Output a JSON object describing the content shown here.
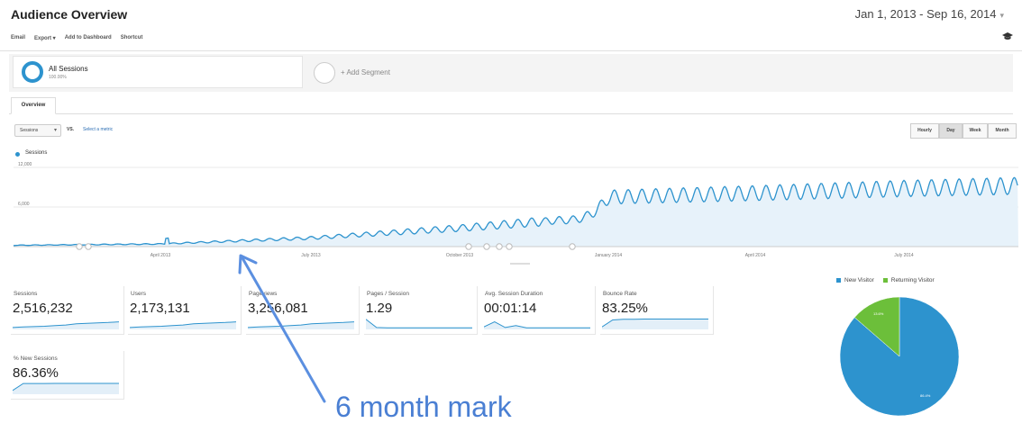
{
  "header": {
    "title": "Audience Overview",
    "date_range": "Jan 1, 2013 - Sep 16, 2014",
    "date_caret": "▾"
  },
  "toolbar": {
    "email": "Email",
    "export": "Export ▾",
    "add_to_dashboard": "Add to Dashboard",
    "shortcut": "Shortcut",
    "icon": "graduation-cap-icon"
  },
  "segments": {
    "all_label": "All Sessions",
    "all_percent": "100.00%",
    "add_label": "+ Add Segment"
  },
  "tabs": {
    "overview": "Overview"
  },
  "chart_controls": {
    "metric": "Sessions",
    "metric_caret": "▾",
    "vs": "VS.",
    "select_metric": "Select a metric",
    "periods": [
      "Hourly",
      "Day",
      "Week",
      "Month"
    ],
    "active_period": "Day"
  },
  "chart_data": {
    "type": "area",
    "series": [
      {
        "name": "Sessions",
        "color": "#2d93ce"
      }
    ],
    "ylim": [
      0,
      12000
    ],
    "y_ticks": [
      "12,000",
      "6,000"
    ],
    "x_ticks": [
      "April 2013",
      "July 2013",
      "October 2013",
      "January 2014",
      "April 2014",
      "July 2014"
    ],
    "trend": [
      {
        "x": "Jan 2013",
        "y": 200
      },
      {
        "x": "Apr 2013",
        "y": 400
      },
      {
        "x": "Jul 2013",
        "y": 1300
      },
      {
        "x": "Oct 2013",
        "y": 2800
      },
      {
        "x": "Dec 2013",
        "y": 4000
      },
      {
        "x": "Jan 2014",
        "y": 7500
      },
      {
        "x": "Apr 2014",
        "y": 8100
      },
      {
        "x": "Jul 2014",
        "y": 8800
      },
      {
        "x": "Sep 2014",
        "y": 9200
      }
    ],
    "weekly_oscillation": true
  },
  "metrics": [
    {
      "label": "Sessions",
      "value": "2,516,232",
      "spark": [
        0.15,
        0.2,
        0.22,
        0.25,
        0.3,
        0.35,
        0.45,
        0.48,
        0.52,
        0.55,
        0.6
      ]
    },
    {
      "label": "Users",
      "value": "2,173,131",
      "spark": [
        0.15,
        0.2,
        0.22,
        0.25,
        0.3,
        0.35,
        0.45,
        0.48,
        0.52,
        0.55,
        0.6
      ]
    },
    {
      "label": "Pageviews",
      "value": "3,256,081",
      "spark": [
        0.15,
        0.2,
        0.22,
        0.25,
        0.3,
        0.35,
        0.45,
        0.48,
        0.52,
        0.55,
        0.6
      ]
    },
    {
      "label": "Pages / Session",
      "value": "1.29",
      "spark": [
        0.8,
        0.15,
        0.12,
        0.12,
        0.12,
        0.12,
        0.12,
        0.12,
        0.12,
        0.12,
        0.12
      ]
    },
    {
      "label": "Avg. Session Duration",
      "value": "00:01:14",
      "spark": [
        0.2,
        0.6,
        0.15,
        0.3,
        0.12,
        0.12,
        0.12,
        0.12,
        0.12,
        0.12,
        0.12
      ]
    },
    {
      "label": "Bounce Rate",
      "value": "83.25%",
      "spark": [
        0.2,
        0.75,
        0.8,
        0.8,
        0.82,
        0.82,
        0.82,
        0.82,
        0.82,
        0.82,
        0.82
      ]
    },
    {
      "label": "% New Sessions",
      "value": "86.36%",
      "spark": [
        0.3,
        0.85,
        0.85,
        0.85,
        0.86,
        0.86,
        0.86,
        0.86,
        0.86,
        0.86,
        0.86
      ]
    }
  ],
  "pie": {
    "legend": [
      {
        "label": "New Visitor",
        "color": "#2d93ce"
      },
      {
        "label": "Returning Visitor",
        "color": "#6cbf3a"
      }
    ],
    "new_pct": 86.4,
    "new_label": "86.4%",
    "returning_label": "13.6%"
  },
  "annotation": {
    "text": "6 month mark",
    "color": "#4a7fd3"
  }
}
